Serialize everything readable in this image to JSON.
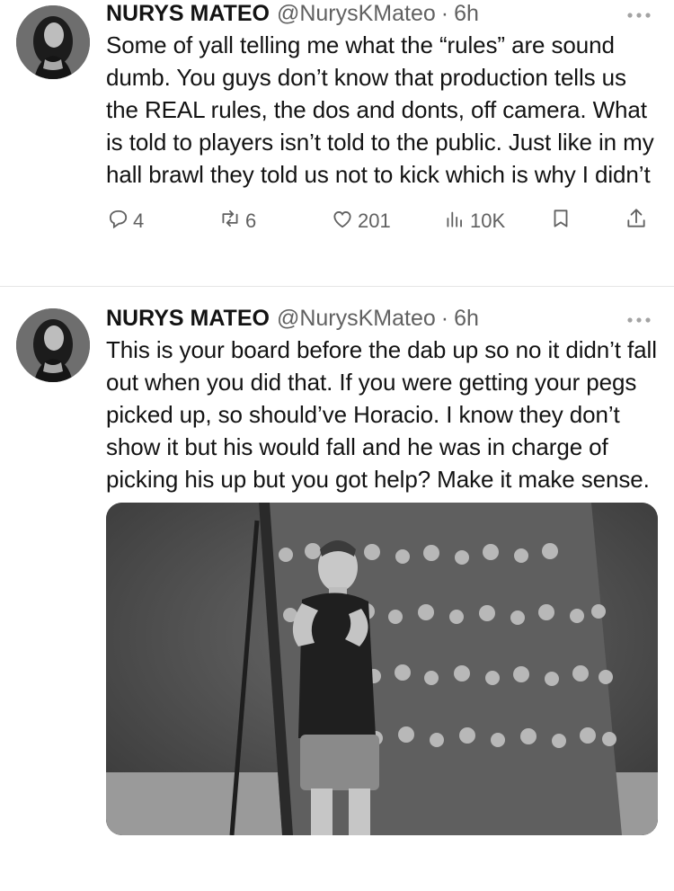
{
  "tweets": [
    {
      "author_name": "NURYS MATEO",
      "handle": "@NurysKMateo",
      "separator": "·",
      "time": "6h",
      "text": "Some of yall telling me what the “rules” are sound dumb. You guys don’t know that production tells us the REAL rules, the dos and donts, off camera. What is told to players isn’t told to the public. Just like in my hall brawl they told us not to kick which is why I didn’t",
      "metrics": {
        "replies": "4",
        "retweets": "6",
        "likes": "201",
        "views": "10K"
      }
    },
    {
      "author_name": "NURYS MATEO",
      "handle": "@NurysKMateo",
      "separator": "·",
      "time": "6h",
      "text": "This is your board before the dab up so no it didn’t fall out when you did that. If you were getting your pegs picked up, so should’ve Horacio. I know they don’t show it but his would fall and he was in charge of picking his up but you got help? Make it make sense."
    }
  ],
  "icons": {
    "reply": "reply-icon",
    "retweet": "retweet-icon",
    "like": "heart-icon",
    "views": "views-icon",
    "bookmark": "bookmark-icon",
    "share": "share-icon",
    "more": "more-icon"
  },
  "colors": {
    "text": "#0f1419",
    "secondary": "#536471",
    "divider": "#e6e6e6"
  }
}
